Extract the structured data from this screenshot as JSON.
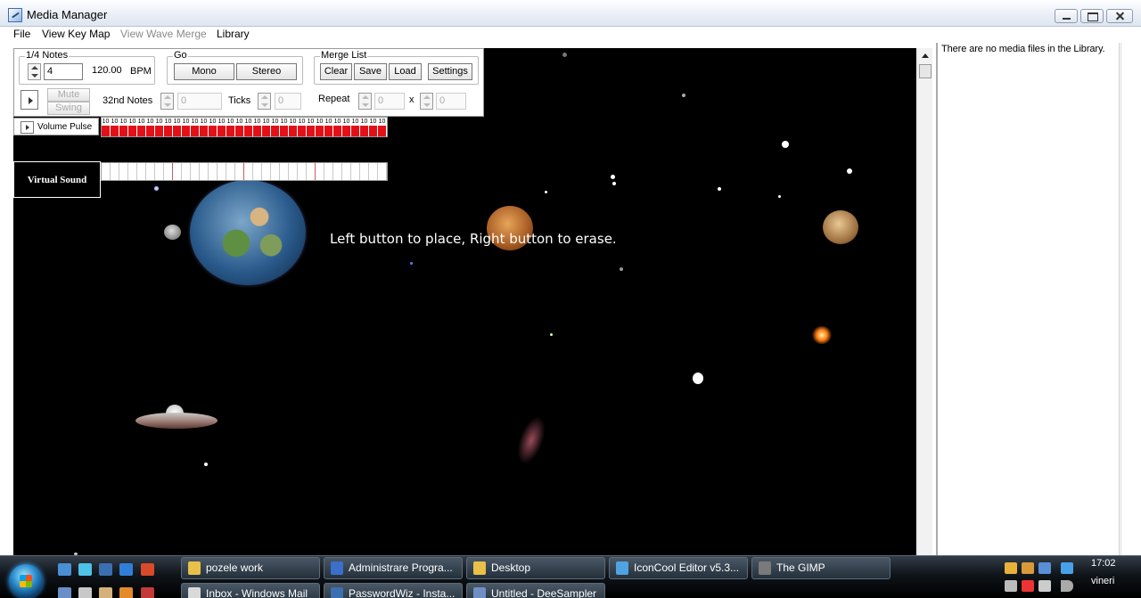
{
  "window": {
    "title": "Media Manager"
  },
  "menu": [
    {
      "label": "File",
      "enabled": true
    },
    {
      "label": "View Key Map",
      "enabled": true
    },
    {
      "label": "View Wave Merge",
      "enabled": false
    },
    {
      "label": "Library",
      "enabled": true
    }
  ],
  "controls": {
    "notes_group_label": "1/4 Notes",
    "notes_value": "4",
    "bpm_value": "120.00",
    "bpm_unit": "BPM",
    "mute_label": "Mute",
    "swing_label": "Swing",
    "notes32_label": "32nd Notes",
    "notes32_value": "0",
    "ticks_label": "Ticks",
    "ticks_value": "0",
    "go_group_label": "Go",
    "mono_label": "Mono",
    "stereo_label": "Stereo",
    "merge_group_label": "Merge List",
    "clear_label": "Clear",
    "save_label": "Save",
    "load_label": "Load",
    "settings_label": "Settings",
    "repeat_label": "Repeat",
    "repeat_value": "0",
    "times_symbol": "x",
    "repeat_count_value": "0"
  },
  "volume_pulse": {
    "label": "Volume Pulse",
    "cells": [
      "10",
      "10",
      "10",
      "10",
      "10",
      "10",
      "10",
      "10",
      "10",
      "10",
      "10",
      "10",
      "10",
      "10",
      "10",
      "10",
      "10",
      "10",
      "10",
      "10",
      "10",
      "10",
      "10",
      "10",
      "10",
      "10",
      "10",
      "10",
      "10",
      "10",
      "10",
      "10"
    ]
  },
  "virtual_sound": {
    "label": "Virtual Sound",
    "cell_count": 32,
    "marks": [
      8,
      16,
      24
    ]
  },
  "canvas": {
    "hint": "Left button to place, Right button to erase."
  },
  "library": {
    "empty_text": "There are no media files in the Library."
  },
  "taskbar": {
    "buttons_row1": [
      {
        "label": "pozele work",
        "icon": "folder-icon",
        "color": "#e8c04a"
      },
      {
        "label": "Administrare Progra...",
        "icon": "control-panel-icon",
        "color": "#3b6fc9"
      },
      {
        "label": "Desktop",
        "icon": "folder-icon",
        "color": "#e8c04a"
      },
      {
        "label": "IconCool Editor v5.3...",
        "icon": "iconcool-icon",
        "color": "#4fa3e0"
      },
      {
        "label": "The GIMP",
        "icon": "gimp-icon",
        "color": "#7a7a7a"
      }
    ],
    "buttons_row2": [
      {
        "label": "Inbox - Windows Mail",
        "icon": "mail-icon",
        "color": "#d9d9d9"
      },
      {
        "label": "PasswordWiz - Insta...",
        "icon": "installer-icon",
        "color": "#3a6fb0"
      },
      {
        "label": "Untitled - DeeSampler",
        "icon": "deesampler-icon",
        "color": "#6f8fc4"
      }
    ],
    "clock_time": "17:02",
    "clock_day": "vineri"
  }
}
